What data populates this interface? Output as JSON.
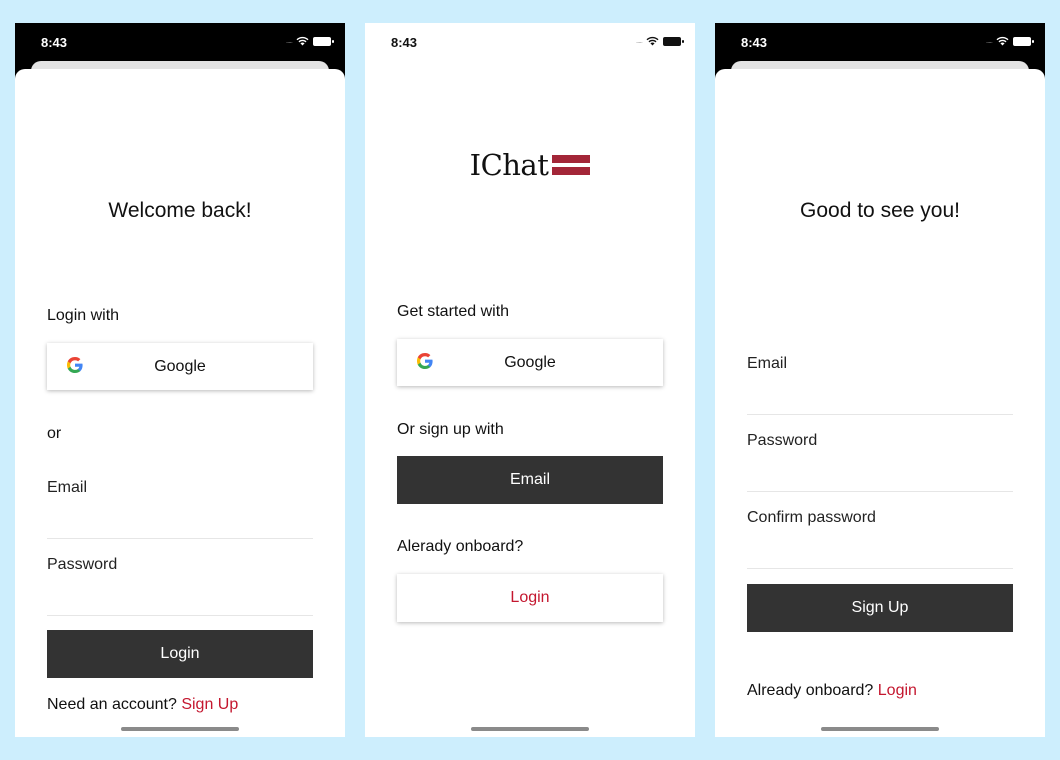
{
  "status": {
    "time": "8:43",
    "signal_dots": "....."
  },
  "colors": {
    "accent": "#c4172f",
    "dark_button": "#333333",
    "background": "#cdeefd"
  },
  "login_screen": {
    "title": "Welcome back!",
    "login_with_label": "Login with",
    "google_button_label": "Google",
    "or_label": "or",
    "email_placeholder": "Email",
    "password_placeholder": "Password",
    "login_button_label": "Login",
    "need_account_text": "Need an account?",
    "signup_link_label": "Sign Up"
  },
  "welcome_screen": {
    "logo_text": "IChat",
    "get_started_label": "Get started with",
    "google_button_label": "Google",
    "or_signup_label": "Or sign up with",
    "email_button_label": "Email",
    "already_onboard_label": "Alerady onboard?",
    "login_button_label": "Login"
  },
  "signup_screen": {
    "title": "Good to see you!",
    "email_placeholder": "Email",
    "password_placeholder": "Password",
    "confirm_password_placeholder": "Confirm password",
    "signup_button_label": "Sign Up",
    "already_onboard_text": "Already onboard?",
    "login_link_label": "Login"
  }
}
